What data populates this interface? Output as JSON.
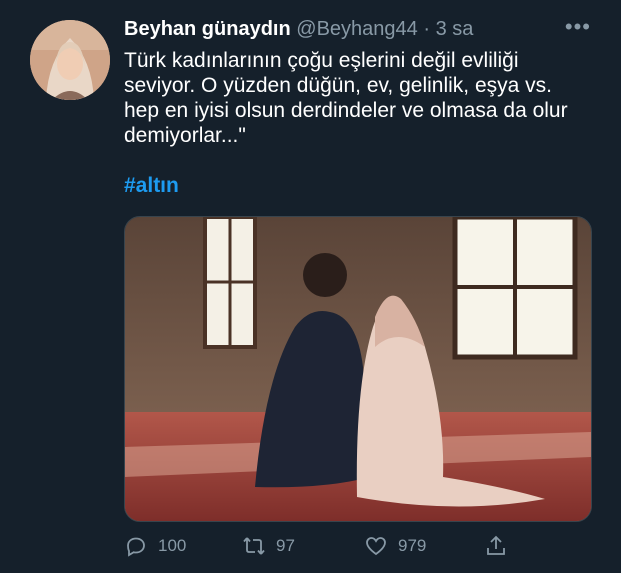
{
  "tweet": {
    "author_name": "Beyhan günaydın",
    "handle": "@Beyhang44",
    "separator": "·",
    "time": "3 sa",
    "more_label": "•••",
    "text": "Türk kadınlarının çoğu eşlerini değil evliliği seviyor. O yüzden düğün, ev, gelinlik, eşya vs. hep en iyisi olsun derdindeler ve olmasa da olur demiyorlar...\"",
    "hashtag": "#altın"
  },
  "actions": {
    "reply_count": "100",
    "retweet_count": "97",
    "like_count": "979"
  },
  "icons": {
    "reply": "reply-icon",
    "retweet": "retweet-icon",
    "like": "heart-icon",
    "share": "share-icon",
    "more": "more-icon"
  },
  "colors": {
    "background": "#15202b",
    "text_primary": "#ffffff",
    "text_secondary": "#8899a6",
    "link": "#1d9bf0"
  }
}
